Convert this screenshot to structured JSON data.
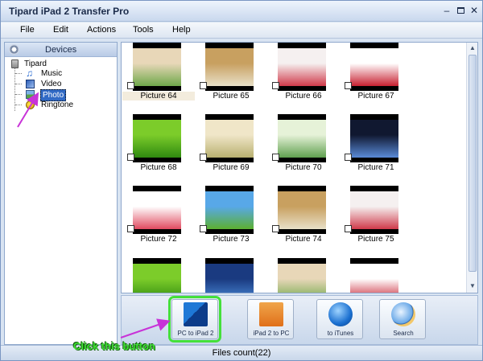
{
  "window": {
    "title": "Tipard iPad 2 Transfer Pro"
  },
  "menu": [
    "File",
    "Edit",
    "Actions",
    "Tools",
    "Help"
  ],
  "sidebar": {
    "header": "Devices",
    "root": "Tipard",
    "items": [
      {
        "label": "Music",
        "icon": "music-icon"
      },
      {
        "label": "Video",
        "icon": "video-icon"
      },
      {
        "label": "Photo",
        "icon": "photo-icon",
        "selected": true
      },
      {
        "label": "Ringtone",
        "icon": "ringtone-icon"
      }
    ]
  },
  "photos": [
    {
      "caption": "Picture 64",
      "colors": [
        "#e8d7b8",
        "#6fa84a"
      ],
      "focused": true
    },
    {
      "caption": "Picture 65",
      "colors": [
        "#c8a060",
        "#e8e0c8"
      ]
    },
    {
      "caption": "Picture 66",
      "colors": [
        "#f5f0f0",
        "#d03a4a"
      ]
    },
    {
      "caption": "Picture 67",
      "colors": [
        "#ffffff",
        "#c82030"
      ]
    },
    {
      "caption": "Picture 68",
      "colors": [
        "#7ccc2a",
        "#2f8a10"
      ]
    },
    {
      "caption": "Picture 69",
      "colors": [
        "#f0e6c8",
        "#b8b070"
      ]
    },
    {
      "caption": "Picture 70",
      "colors": [
        "#e6f2d8",
        "#60a050"
      ]
    },
    {
      "caption": "Picture 71",
      "colors": [
        "#101830",
        "#5a8ad8"
      ]
    },
    {
      "caption": "Picture 72",
      "colors": [
        "#ffffff",
        "#e04a60"
      ]
    },
    {
      "caption": "Picture 73",
      "colors": [
        "#58a8e8",
        "#5cb030"
      ]
    },
    {
      "caption": "Picture 74",
      "colors": [
        "#c8a060",
        "#e8e0c8"
      ]
    },
    {
      "caption": "Picture 75",
      "colors": [
        "#f5f0f0",
        "#d03a4a"
      ]
    },
    {
      "caption": "",
      "colors": [
        "#7ccc2a",
        "#2f8a10"
      ]
    },
    {
      "caption": "",
      "colors": [
        "#1a3a80",
        "#4a8ad8"
      ]
    },
    {
      "caption": "",
      "colors": [
        "#e8d7b8",
        "#6fa84a"
      ]
    },
    {
      "caption": "",
      "colors": [
        "#ffffff",
        "#c82030"
      ]
    }
  ],
  "toolbar": {
    "buttons": [
      {
        "label": "PC to iPad 2",
        "icon": "pc-to-ipad-icon",
        "highlighted": true
      },
      {
        "label": "iPad 2 to PC",
        "icon": "ipad-to-pc-icon"
      },
      {
        "label": "to iTunes",
        "icon": "itunes-icon"
      },
      {
        "label": "Search",
        "icon": "search-icon"
      }
    ]
  },
  "status": {
    "text": "Files count(22)"
  },
  "annotation": {
    "text": "Click this button",
    "color": "#3fe034",
    "arrow_color": "#c833d8"
  }
}
